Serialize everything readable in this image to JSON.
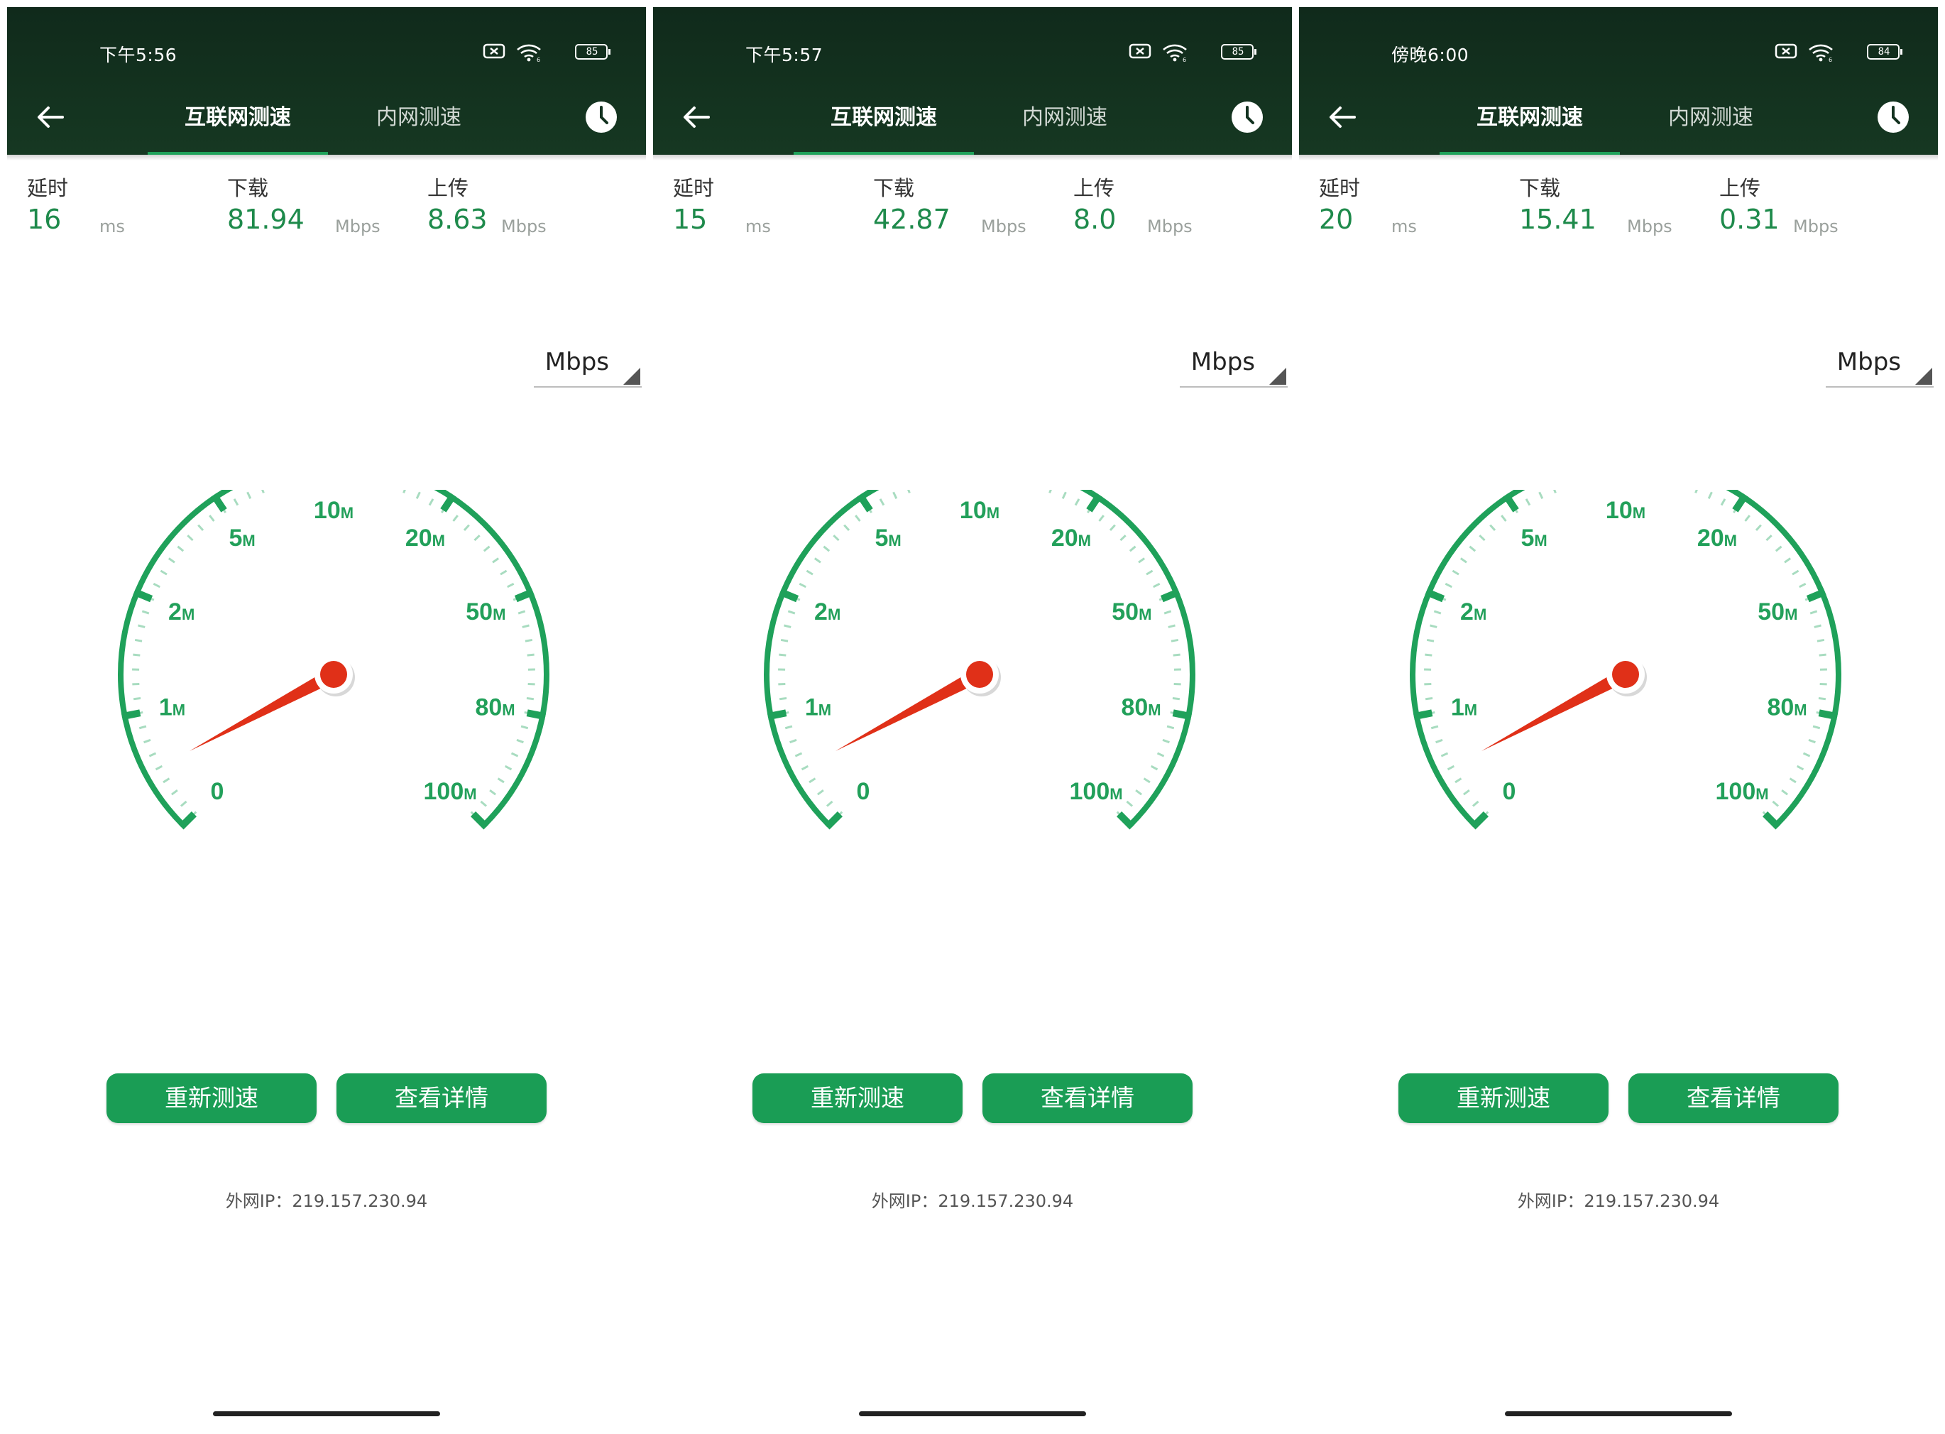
{
  "common": {
    "tab_internet": "互联网测速",
    "tab_intranet": "内网测速",
    "latency_label": "延时",
    "download_label": "下载",
    "upload_label": "上传",
    "latency_unit": "ms",
    "speed_unit": "Mbps",
    "unit_selector": "Mbps",
    "retest_button": "重新测速",
    "details_button": "查看详情",
    "gauge_labels": [
      {
        "value": "0",
        "unit": ""
      },
      {
        "value": "1",
        "unit": "M"
      },
      {
        "value": "2",
        "unit": "M"
      },
      {
        "value": "5",
        "unit": "M"
      },
      {
        "value": "10",
        "unit": "M"
      },
      {
        "value": "20",
        "unit": "M"
      },
      {
        "value": "50",
        "unit": "M"
      },
      {
        "value": "80",
        "unit": "M"
      },
      {
        "value": "100",
        "unit": "M"
      }
    ],
    "colors": {
      "accent": "#1a9d55",
      "gauge": "#1fa15a",
      "needle": "#e03018",
      "header": "#133220"
    }
  },
  "screens": [
    {
      "status_time": "下午5:56",
      "battery": "85",
      "latency": "16",
      "download": "81.94",
      "upload": "8.63",
      "ip": "外网IP：219.157.230.94"
    },
    {
      "status_time": "下午5:57",
      "battery": "85",
      "latency": "15",
      "download": "42.87",
      "upload": "8.0",
      "ip": "外网IP：219.157.230.94"
    },
    {
      "status_time": "傍晚6:00",
      "battery": "84",
      "latency": "20",
      "download": "15.41",
      "upload": "0.31",
      "ip": "外网IP：219.157.230.94"
    }
  ]
}
